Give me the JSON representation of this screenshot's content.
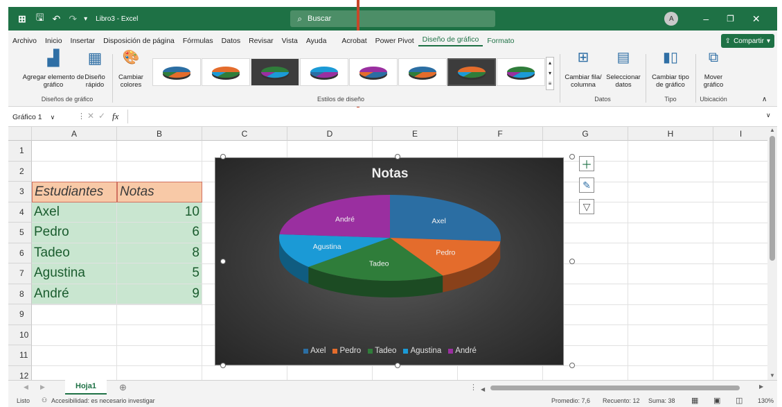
{
  "titlebar": {
    "file_name": "Libro3 - Excel",
    "search_placeholder": "Buscar",
    "user_initial": "A"
  },
  "menu": [
    "Archivo",
    "Inicio",
    "Insertar",
    "Disposición de página",
    "Fórmulas",
    "Datos",
    "Revisar",
    "Vista",
    "Ayuda",
    "Acrobat",
    "Power Pivot",
    "Diseño de gráfico",
    "Formato"
  ],
  "menu_active": "Diseño de gráfico",
  "share_label": "Compartir",
  "ribbon": {
    "add_element": "Agregar elemento de gráfico",
    "quick_layout": "Diseño rápido",
    "change_colors": "Cambiar colores",
    "group_layouts": "Diseños de gráfico",
    "group_styles": "Estilos de diseño",
    "switch_row_col": "Cambiar fila/ columna",
    "select_data": "Seleccionar datos",
    "group_data": "Datos",
    "change_type": "Cambiar tipo de gráfico",
    "group_type": "Tipo",
    "move_chart": "Mover gráfico",
    "group_location": "Ubicación"
  },
  "formula_bar": {
    "name_box": "Gráfico 1",
    "fx": "fx",
    "value": ""
  },
  "columns": [
    "A",
    "B",
    "C",
    "D",
    "E",
    "F",
    "G",
    "H",
    "I"
  ],
  "rows": [
    "1",
    "2",
    "3",
    "4",
    "5",
    "6",
    "7",
    "8",
    "9",
    "10",
    "11",
    "12"
  ],
  "table": {
    "headers": [
      "Estudiantes",
      "Notas"
    ],
    "rows": [
      [
        "Axel",
        "10"
      ],
      [
        "Pedro",
        "6"
      ],
      [
        "Tadeo",
        "8"
      ],
      [
        "Agustina",
        "5"
      ],
      [
        "André",
        "9"
      ]
    ]
  },
  "chart_data": {
    "type": "pie",
    "title": "Notas",
    "categories": [
      "Axel",
      "Pedro",
      "Tadeo",
      "Agustina",
      "André"
    ],
    "values": [
      10,
      6,
      8,
      5,
      9
    ],
    "colors": [
      "#2b6ea3",
      "#e46c2c",
      "#2f7d3a",
      "#1b9ad6",
      "#9a2fa0"
    ],
    "legend": "bottom"
  },
  "sheet_tab": "Hoja1",
  "status": {
    "ready": "Listo",
    "accessibility": "Accesibilidad: es necesario investigar",
    "average": "Promedio: 7,6",
    "count": "Recuento: 12",
    "sum": "Suma: 38",
    "zoom": "130%"
  }
}
